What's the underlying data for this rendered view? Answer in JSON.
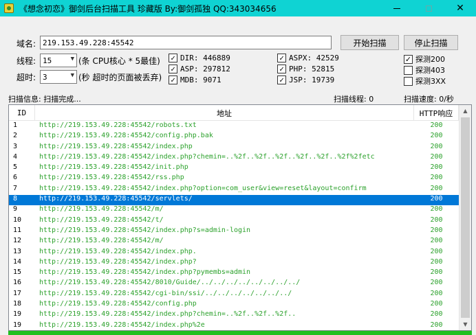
{
  "window": {
    "title": "《想念初恋》御剑后台扫描工具 珍藏版 By:御剑孤独 QQ:343034656",
    "minimize": "—",
    "maximize": "□",
    "close": "✕"
  },
  "form": {
    "domain_label": "域名:",
    "domain_value": "219.153.49.228:45542",
    "threads_label": "线程:",
    "threads_value": "15",
    "threads_hint": "(条 CPU核心 * 5最佳)",
    "timeout_label": "超时:",
    "timeout_value": "3",
    "timeout_hint": "(秒 超时的页面被丢弃)",
    "start_button": "开始扫描",
    "stop_button": "停止扫描"
  },
  "dicts": [
    {
      "label": "DIR: 446889",
      "checked": true
    },
    {
      "label": "ASP: 297812",
      "checked": true
    },
    {
      "label": "MDB: 9071",
      "checked": true
    },
    {
      "label": "ASPX: 42529",
      "checked": true
    },
    {
      "label": "PHP: 52815",
      "checked": true
    },
    {
      "label": "JSP: 19739",
      "checked": true
    },
    {
      "label": "探测200",
      "checked": true
    },
    {
      "label": "探测403",
      "checked": false
    },
    {
      "label": "探测3XX",
      "checked": false
    }
  ],
  "checkmark": "✓",
  "status": {
    "info": "扫描信息: 扫描完成...",
    "threads": "扫描线程: 0",
    "speed": "扫描速度: 0/秒"
  },
  "table": {
    "headers": [
      "ID",
      "地址",
      "HTTP响应"
    ],
    "rows": [
      {
        "id": "1",
        "url": "http://219.153.49.228:45542/robots.txt",
        "code": "200"
      },
      {
        "id": "2",
        "url": "http://219.153.49.228:45542/config.php.bak",
        "code": "200"
      },
      {
        "id": "3",
        "url": "http://219.153.49.228:45542/index.php",
        "code": "200"
      },
      {
        "id": "4",
        "url": "http://219.153.49.228:45542/index.php?chemin=..%2f..%2f..%2f..%2f..%2f..%2f%2fetc",
        "code": "200"
      },
      {
        "id": "5",
        "url": "http://219.153.49.228:45542/init.php",
        "code": "200"
      },
      {
        "id": "6",
        "url": "http://219.153.49.228:45542/rss.php",
        "code": "200"
      },
      {
        "id": "7",
        "url": "http://219.153.49.228:45542/index.php?option=com_user&view=reset&layout=confirm",
        "code": "200"
      },
      {
        "id": "8",
        "url": "http://219.153.49.228:45542/servlets/",
        "code": "200",
        "selected": true
      },
      {
        "id": "9",
        "url": "http://219.153.49.228:45542/m/",
        "code": "200"
      },
      {
        "id": "10",
        "url": "http://219.153.49.228:45542/t/",
        "code": "200"
      },
      {
        "id": "11",
        "url": "http://219.153.49.228:45542/index.php?s=admin-login",
        "code": "200"
      },
      {
        "id": "12",
        "url": "http://219.153.49.228:45542/m/",
        "code": "200"
      },
      {
        "id": "13",
        "url": "http://219.153.49.228:45542/index.php.",
        "code": "200"
      },
      {
        "id": "14",
        "url": "http://219.153.49.228:45542/index.php?",
        "code": "200"
      },
      {
        "id": "15",
        "url": "http://219.153.49.228:45542/index.php?pymembs=admin",
        "code": "200"
      },
      {
        "id": "16",
        "url": "http://219.153.49.228:45542/8010/Guide/../../../../../../../../",
        "code": "200"
      },
      {
        "id": "17",
        "url": "http://219.153.49.228:45542/cgi-bin/ssi/../../../../../../../",
        "code": "200"
      },
      {
        "id": "18",
        "url": "http://219.153.49.228:45542/config.php",
        "code": "200"
      },
      {
        "id": "19",
        "url": "http://219.153.49.228:45542/index.php?chemin=..%2f..%2f..%2f..",
        "code": "200"
      },
      {
        "id": "19",
        "url": "http://219.153.49.228:45542/index.php%2e",
        "code": "200"
      }
    ]
  },
  "colors": {
    "titlebar": "#0fd3d3",
    "url_green": "#2ba12b",
    "selection": "#0078d7"
  }
}
